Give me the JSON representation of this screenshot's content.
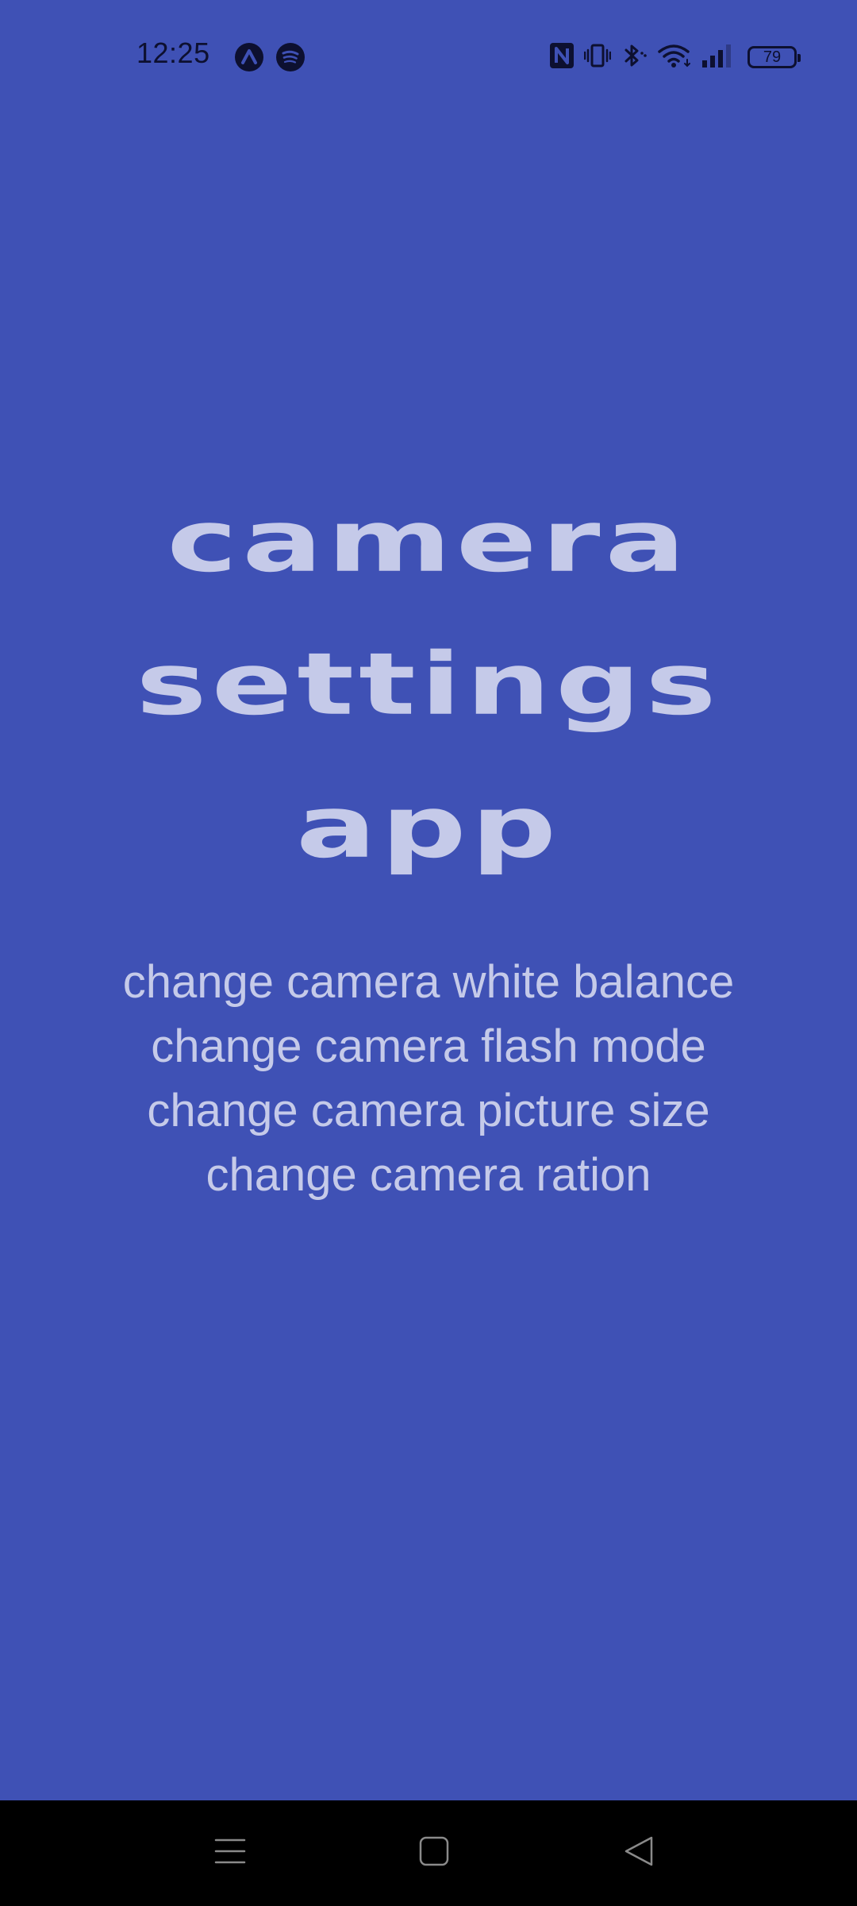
{
  "status_bar": {
    "time": "12:25",
    "left_icons": [
      "arc-app-icon",
      "spotify-icon"
    ],
    "right_icons": [
      "nfc-icon",
      "vibrate-icon",
      "bluetooth-icon",
      "wifi-icon",
      "cellular-signal-icon",
      "battery-icon"
    ],
    "battery_level": "79"
  },
  "main": {
    "title_lines": [
      "camera",
      "settings",
      "app"
    ],
    "features": [
      "change camera white balance",
      "change camera flash mode",
      "change camera picture size",
      "change camera ration"
    ]
  },
  "nav_bar": {
    "buttons": [
      "menu-icon",
      "home-icon",
      "back-icon"
    ]
  },
  "colors": {
    "background": "#3f51b5",
    "text": "#c5cae9",
    "status_icons": "#0d1030",
    "nav_bar": "#000000"
  }
}
